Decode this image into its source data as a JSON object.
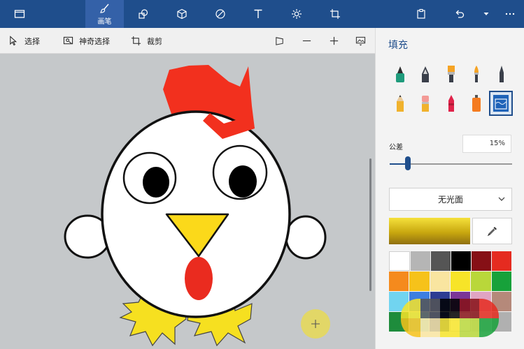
{
  "toolbar": {
    "brush_label": "画笔",
    "icons": [
      "folder-icon",
      "brush-icon",
      "shapes-2d-icon",
      "cube-3d-icon",
      "sticker-icon",
      "text-icon",
      "effects-icon",
      "canvas-crop-icon",
      "paste-icon",
      "undo-icon",
      "history-dropdown-icon",
      "more-icon"
    ]
  },
  "subbar": {
    "select_label": "选择",
    "magic_select_label": "神奇选择",
    "crop_label": "裁剪"
  },
  "panel": {
    "title": "填充",
    "tolerance_label": "公差",
    "tolerance_value": "15%",
    "tolerance_level": 0.15,
    "finish_value": "无光面",
    "active_color": "#d4b81a",
    "tools": [
      "marker",
      "calligraphy-pen",
      "oil-brush",
      "watercolor",
      "pixel-pen",
      "pencil",
      "eraser",
      "crayon",
      "spray-can",
      "fill"
    ],
    "palette": [
      [
        "#ffffff",
        "#b5b5b5",
        "#555555",
        "#000000",
        "#861016",
        "#e52b20"
      ],
      [
        "#f58a1d",
        "#f6c21a",
        "#f9e5a0",
        "#f7e428",
        "#b9d73a",
        "#17a13a"
      ],
      [
        "#71d4f0",
        "#3d7ee0",
        "#2d3d93",
        "#7b3596",
        "#e0a4c2",
        "#b5897a"
      ],
      [
        "#1e8c3c",
        "#88d7f0",
        "#2e4ba6",
        "#ffffff",
        "#dcdcdc",
        "#b0b0b0"
      ]
    ],
    "overlay_colors": [
      [
        "#f7e428",
        "#555555",
        "#000000",
        "#861016",
        "#e52b20"
      ],
      [
        "#f6c21a",
        "#f9e5a0",
        "#f7e428",
        "#b9d73a",
        "#17a13a"
      ]
    ]
  },
  "canvas": {
    "colors": {
      "comb": "#f2301e",
      "beak": "#fbd91a",
      "mouth": "#ea2b1f",
      "feet": "#f6e020"
    }
  }
}
